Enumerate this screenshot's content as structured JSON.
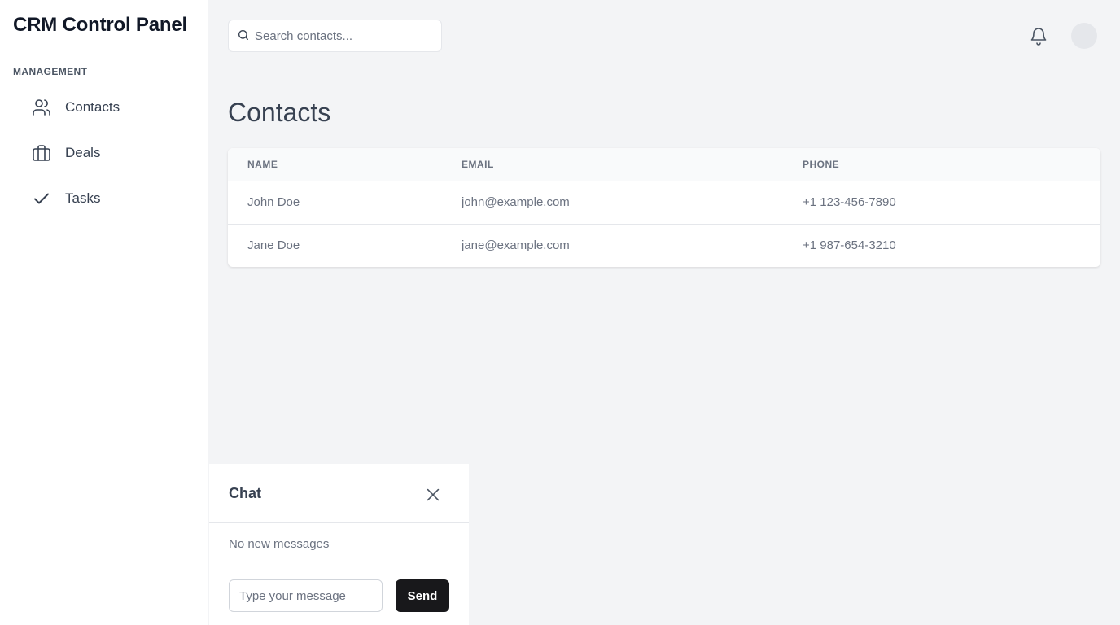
{
  "app": {
    "title": "CRM Control Panel"
  },
  "sidebar": {
    "section_label": "MANAGEMENT",
    "items": [
      {
        "label": "Contacts",
        "icon": "users-icon"
      },
      {
        "label": "Deals",
        "icon": "briefcase-icon"
      },
      {
        "label": "Tasks",
        "icon": "check-icon"
      }
    ]
  },
  "header": {
    "search_placeholder": "Search contacts...",
    "search_value": ""
  },
  "main": {
    "title": "Contacts",
    "table": {
      "columns": [
        "NAME",
        "EMAIL",
        "PHONE"
      ],
      "rows": [
        {
          "name": "John Doe",
          "email": "john@example.com",
          "phone": "+1 123-456-7890"
        },
        {
          "name": "Jane Doe",
          "email": "jane@example.com",
          "phone": "+1 987-654-3210"
        }
      ]
    }
  },
  "chat": {
    "title": "Chat",
    "empty_text": "No new messages",
    "input_placeholder": "Type your message",
    "input_value": "",
    "send_label": "Send"
  },
  "colors": {
    "sidebar_bg": "#ffffff",
    "content_bg": "#f3f4f6",
    "send_button": "#18181b",
    "text_primary": "#374151",
    "text_muted": "#6b7280"
  }
}
